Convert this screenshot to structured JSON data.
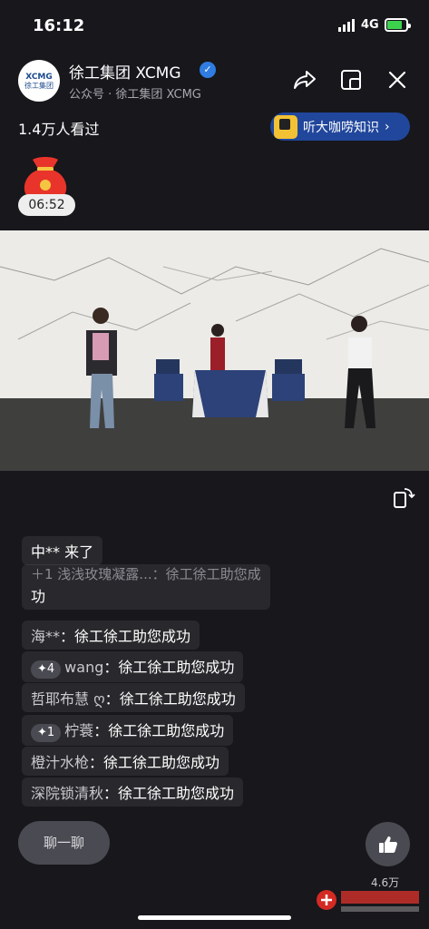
{
  "status": {
    "time": "16:12",
    "network": "4G"
  },
  "header": {
    "logo": {
      "brand": "XCMG",
      "cn": "徐工集团"
    },
    "account_name": "徐工集团 XCMG",
    "account_sub": "公众号 · 徐工集团 XCMG",
    "viewers": "1.4万人看过",
    "tag_label": "听大咖唠知识",
    "tag_arrow": "›"
  },
  "red_packet": {
    "timer": "06:52"
  },
  "chat": {
    "join": "中** 来了",
    "faded_line": "＋1 浅浅玫瑰凝露...：徐工徐工助您成",
    "faded_tail": "功",
    "messages": [
      {
        "badge": "",
        "name": "海**",
        "text": "徐工徐工助您成功"
      },
      {
        "badge": "✦4",
        "name": "wang",
        "text": "徐工徐工助您成功"
      },
      {
        "badge": "",
        "name": "哲耶布慧 ღ",
        "text": "徐工徐工助您成功"
      },
      {
        "badge": "✦1",
        "name": "柠蓑",
        "text": "徐工徐工助您成功"
      },
      {
        "badge": "",
        "name": "橙汁水枪",
        "text": "徐工徐工助您成功"
      },
      {
        "badge": "",
        "name": "深院锁清秋",
        "text": "徐工徐工助您成功"
      }
    ],
    "separator": "：",
    "input_label": "聊一聊"
  },
  "likes": "4.6万",
  "colors": {
    "accent": "#21479c",
    "verified": "#2f7de1",
    "battery": "#3cd34d"
  }
}
